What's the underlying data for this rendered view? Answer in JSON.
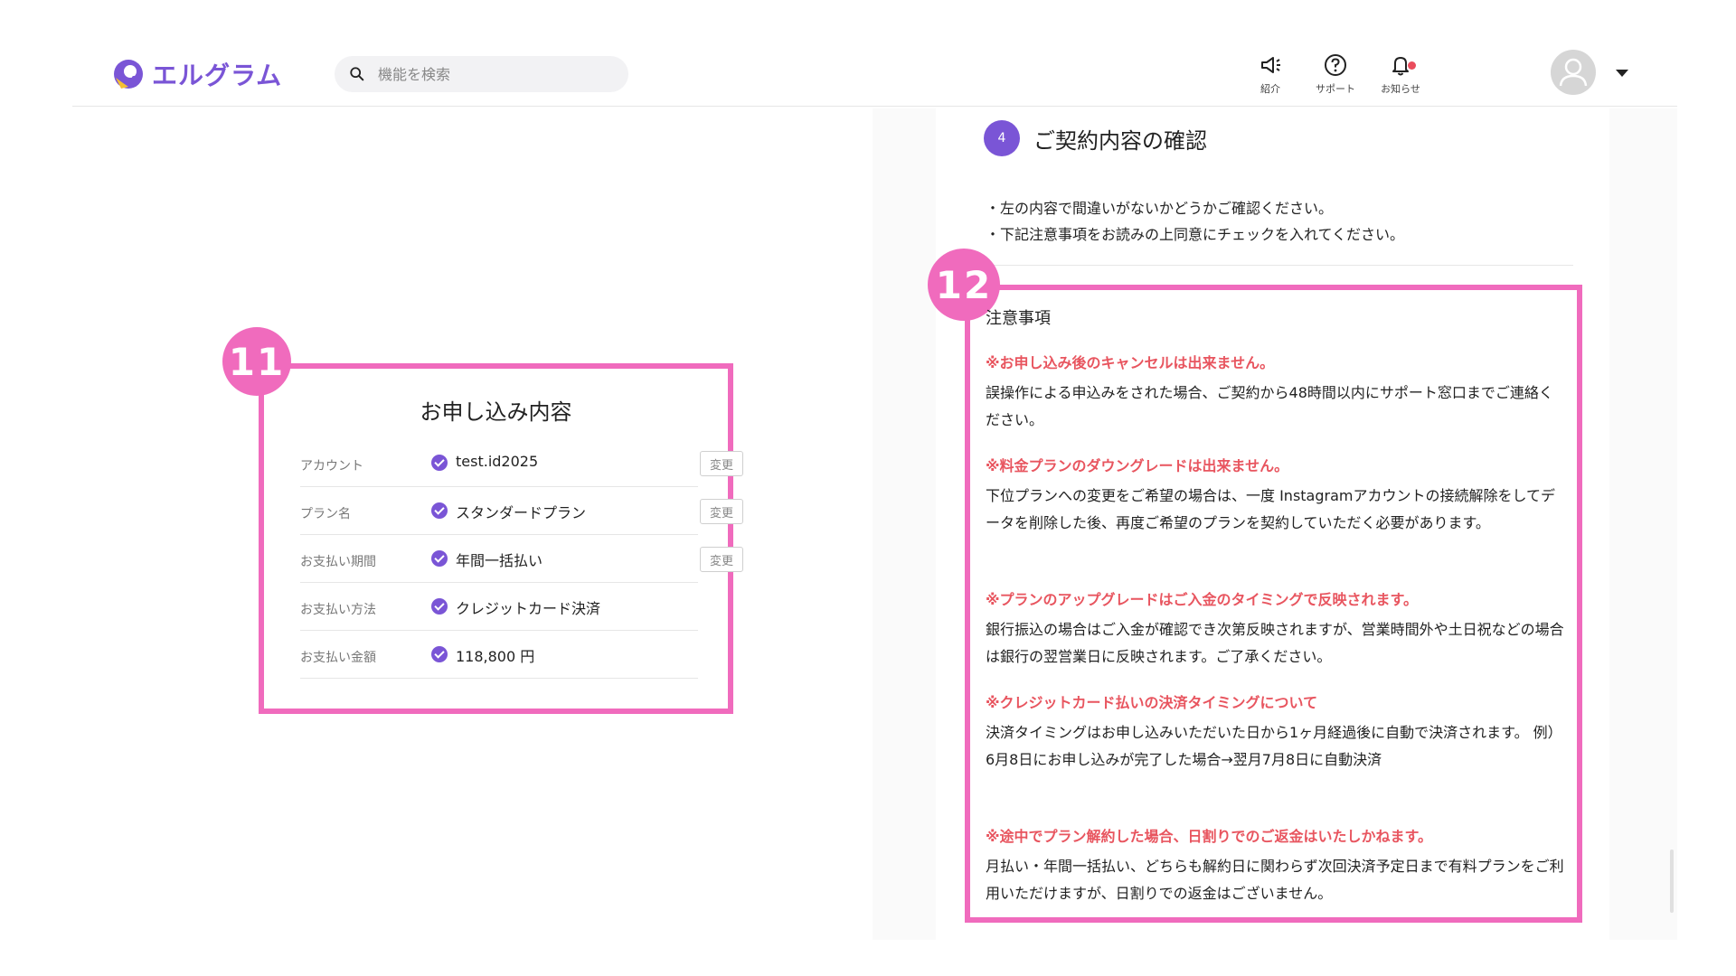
{
  "app": {
    "name": "エルグラム",
    "brand_color": "#7a55d6",
    "highlight_color": "#f06bbd",
    "warning_color": "#e8555f"
  },
  "search": {
    "placeholder": "機能を検索"
  },
  "header": {
    "intro_label": "紹介",
    "support_label": "サポート",
    "notice_label": "お知らせ"
  },
  "step": {
    "number": "4",
    "title": "ご契約内容の確認"
  },
  "instructions": [
    "・左の内容で間違いがないかどうかご確認ください。",
    "・下記注意事項をお読みの上同意にチェックを入れてください。"
  ],
  "badges": {
    "summary": "11",
    "notes": "12"
  },
  "summary": {
    "title": "お申し込み内容",
    "change_label": "変更",
    "rows": [
      {
        "label": "アカウント",
        "value": "test.id2025"
      },
      {
        "label": "プラン名",
        "value": "スタンダードプラン"
      },
      {
        "label": "お支払い期間",
        "value": "年間一括払い"
      },
      {
        "label": "お支払い方法",
        "value": "クレジットカード決済"
      },
      {
        "label": "お支払い金額",
        "value": "118,800 円"
      }
    ]
  },
  "notes": {
    "title": "注意事項",
    "items": [
      {
        "head": "※お申し込み後のキャンセルは出来ません。",
        "body": "誤操作による申込みをされた場合、ご契約から48時間以内にサポート窓口までご連絡ください。"
      },
      {
        "head": "※料金プランのダウングレードは出来ません。",
        "body": "下位プランへの変更をご希望の場合は、一度 Instagramアカウントの接続解除をしてデータを削除した後、再度ご希望のプランを契約していただく必要があります。"
      },
      {
        "head": "※プランのアップグレードはご入金のタイミングで反映されます。",
        "body": "銀行振込の場合はご入金が確認でき次第反映されますが、営業時間外や土日祝などの場合は銀行の翌営業日に反映されます。ご了承ください。"
      },
      {
        "head": "※クレジットカード払いの決済タイミングについて",
        "body": "決済タイミングはお申し込みいただいた日から1ヶ月経過後に自動で決済されます。 例）6月8日にお申し込みが完了した場合→翌月7月8日に自動決済"
      },
      {
        "head": "※途中でプラン解約した場合、日割りでのご返金はいたしかねます。",
        "body": "月払い・年間一括払い、どちらも解約日に関わらず次回決済予定日まで有料プランをご利用いただけますが、日割りでの返金はございません。"
      }
    ]
  }
}
